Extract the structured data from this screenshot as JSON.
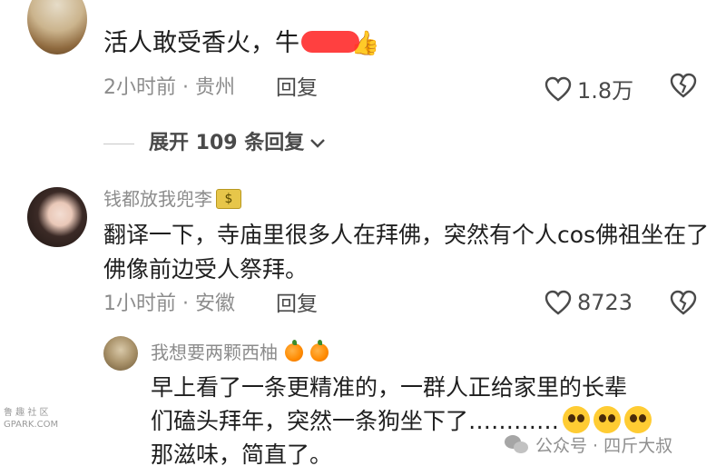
{
  "comment1": {
    "text": "活人敢受香火，牛",
    "time_location": "2小时前 · 贵州",
    "reply_label": "回复",
    "likes": "1.8万"
  },
  "expand": {
    "label": "展开 109 条回复"
  },
  "comment2": {
    "username": "钱都放我兜李",
    "text": "翻译一下，寺庙里很多人在拜佛，突然有个人cos佛祖坐在了佛像前边受人祭拜。",
    "time_location": "1小时前 · 安徽",
    "reply_label": "回复",
    "likes": "8723"
  },
  "reply1": {
    "username": "我想要两颗西柚",
    "text_line1": "早上看了一条更精准的，一群人正给家里的长辈",
    "text_line2": "们磕头拜年，突然一条狗坐下了…………",
    "text_line3": "那滋味，简直了。"
  },
  "watermarks": {
    "left_line1": "鲁 趣 社 区",
    "left_line2": "GPARK.COM",
    "right": "公众号 · 四斤大叔"
  },
  "icons": {
    "heart": "heart-outline-icon",
    "dislike": "broken-heart-icon",
    "chevron": "chevron-down-icon",
    "money": "money-bag-icon",
    "orange": "orange-icon",
    "emoji": "pleading-face-icon",
    "wechat": "wechat-icon"
  }
}
